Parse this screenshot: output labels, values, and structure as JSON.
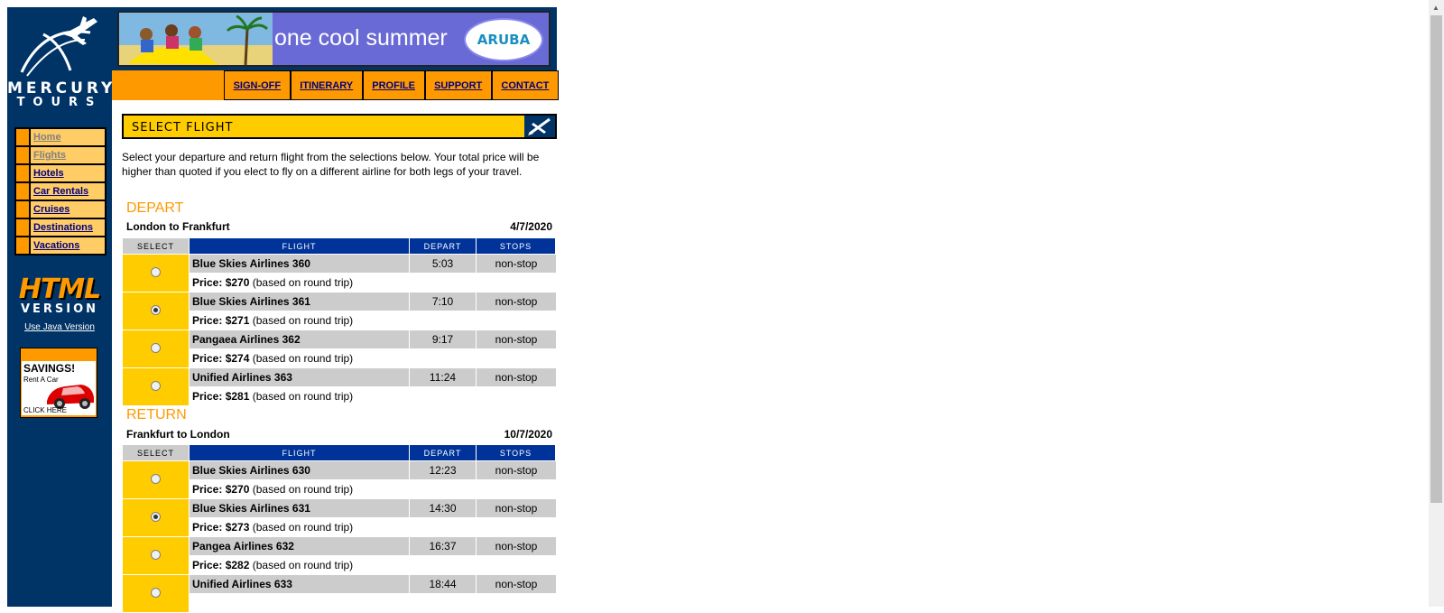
{
  "brand": {
    "line1": "MERCURY",
    "line2": "TOURS"
  },
  "left_nav": [
    {
      "label": "Home",
      "visited": true
    },
    {
      "label": "Flights",
      "visited": true
    },
    {
      "label": "Hotels",
      "visited": false
    },
    {
      "label": "Car Rentals",
      "visited": false
    },
    {
      "label": "Cruises",
      "visited": false
    },
    {
      "label": "Destinations",
      "visited": false
    },
    {
      "label": "Vacations",
      "visited": false
    }
  ],
  "html_version": {
    "big": "HTML",
    "small": "VERSION",
    "link": "Use Java Version"
  },
  "ad": {
    "title": "SAVINGS!",
    "subtitle": "Rent A Car",
    "cta": "CLICK HERE"
  },
  "banner": {
    "text": "one cool summer",
    "brand": "ARUBA"
  },
  "top_nav": [
    "SIGN-OFF",
    "ITINERARY",
    "PROFILE",
    "SUPPORT",
    "CONTACT"
  ],
  "section_title": "SELECT FLIGHT",
  "intro": "Select your departure and return flight from the selections below. Your total price will be higher than quoted if you elect to fly on a different airline for both legs of your travel.",
  "columns": {
    "select": "SELECT",
    "flight": "FLIGHT",
    "depart": "DEPART",
    "stops": "STOPS"
  },
  "price_prefix": "Price:",
  "price_note": "(based on round trip)",
  "depart": {
    "label": "DEPART",
    "route": "London to Frankfurt",
    "date": "4/7/2020",
    "flights": [
      {
        "name": "Blue Skies Airlines 360",
        "time": "5:03",
        "stops": "non-stop",
        "price": "$270",
        "selected": false
      },
      {
        "name": "Blue Skies Airlines 361",
        "time": "7:10",
        "stops": "non-stop",
        "price": "$271",
        "selected": true
      },
      {
        "name": "Pangaea Airlines 362",
        "time": "9:17",
        "stops": "non-stop",
        "price": "$274",
        "selected": false
      },
      {
        "name": "Unified Airlines 363",
        "time": "11:24",
        "stops": "non-stop",
        "price": "$281",
        "selected": false
      }
    ]
  },
  "return": {
    "label": "RETURN",
    "route": "Frankfurt to London",
    "date": "10/7/2020",
    "flights": [
      {
        "name": "Blue Skies Airlines 630",
        "time": "12:23",
        "stops": "non-stop",
        "price": "$270",
        "selected": false
      },
      {
        "name": "Blue Skies Airlines 631",
        "time": "14:30",
        "stops": "non-stop",
        "price": "$273",
        "selected": true
      },
      {
        "name": "Pangea Airlines 632",
        "time": "16:37",
        "stops": "non-stop",
        "price": "$282",
        "selected": false
      },
      {
        "name": "Unified Airlines 633",
        "time": "18:44",
        "stops": "non-stop",
        "price": "",
        "selected": false
      }
    ]
  }
}
